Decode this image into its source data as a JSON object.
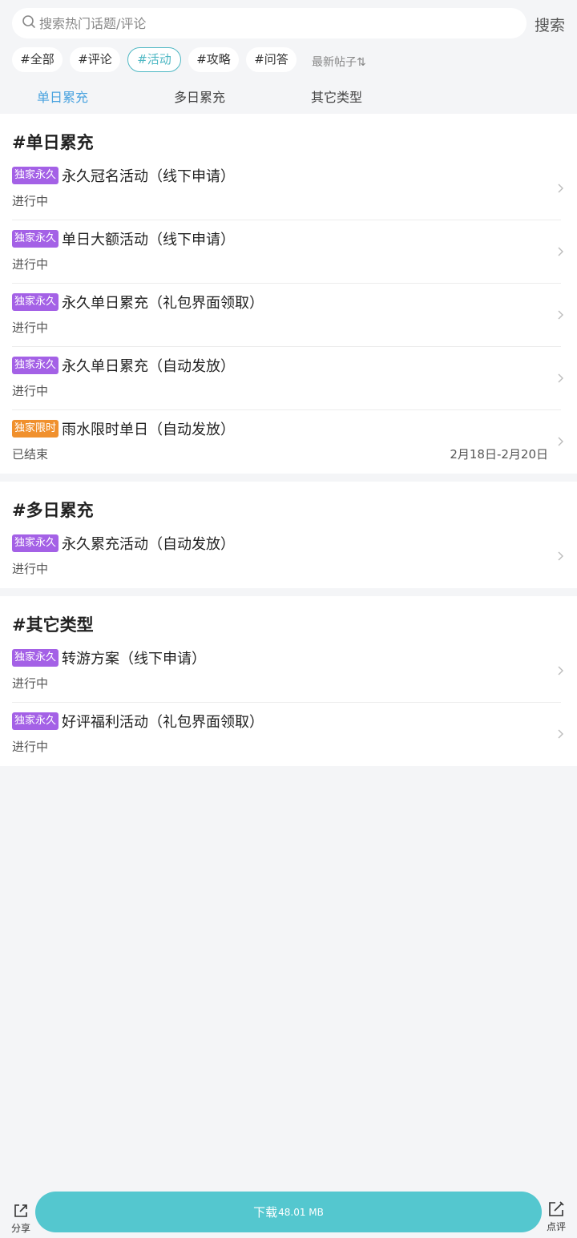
{
  "search": {
    "placeholder": "搜索热门话题/评论",
    "button_label": "搜索"
  },
  "tags": [
    {
      "label": "#全部",
      "active": false
    },
    {
      "label": "#评论",
      "active": false
    },
    {
      "label": "#活动",
      "active": true
    },
    {
      "label": "#攻略",
      "active": false
    },
    {
      "label": "#问答",
      "active": false
    }
  ],
  "sort_label": "最新帖子⇅",
  "subtabs": [
    {
      "label": "单日累充",
      "active": true
    },
    {
      "label": "多日累充",
      "active": false
    },
    {
      "label": "其它类型",
      "active": false
    }
  ],
  "sections": [
    {
      "title": "#单日累充",
      "items": [
        {
          "badge": "独家永久",
          "badge_color": "#a461e6",
          "title": "永久冠名活动（线下申请）",
          "status": "进行中",
          "date": ""
        },
        {
          "badge": "独家永久",
          "badge_color": "#a461e6",
          "title": "单日大额活动（线下申请）",
          "status": "进行中",
          "date": ""
        },
        {
          "badge": "独家永久",
          "badge_color": "#a461e6",
          "title": "永久单日累充（礼包界面领取）",
          "status": "进行中",
          "date": ""
        },
        {
          "badge": "独家永久",
          "badge_color": "#a461e6",
          "title": "永久单日累充（自动发放）",
          "status": "进行中",
          "date": ""
        },
        {
          "badge": "独家限时",
          "badge_color": "#f0902d",
          "title": "雨水限时单日（自动发放）",
          "status": "已结束",
          "date": "2月18日-2月20日"
        }
      ]
    },
    {
      "title": "#多日累充",
      "items": [
        {
          "badge": "独家永久",
          "badge_color": "#a461e6",
          "title": "永久累充活动（自动发放）",
          "status": "进行中",
          "date": ""
        }
      ]
    },
    {
      "title": "#其它类型",
      "items": [
        {
          "badge": "独家永久",
          "badge_color": "#a461e6",
          "title": "转游方案（线下申请）",
          "status": "进行中",
          "date": ""
        },
        {
          "badge": "独家永久",
          "badge_color": "#a461e6",
          "title": "好评福利活动（礼包界面领取）",
          "status": "进行中",
          "date": ""
        }
      ]
    }
  ],
  "bottom_bar": {
    "share_label": "分享",
    "download_label": "下载",
    "download_size": "48.01 MB",
    "review_label": "点评"
  },
  "colors": {
    "accent": "#4fb8c4",
    "subtab_active": "#4aa3df",
    "download_button": "#54c7cf",
    "badge_permanent": "#a461e6",
    "badge_limited": "#f0902d"
  }
}
